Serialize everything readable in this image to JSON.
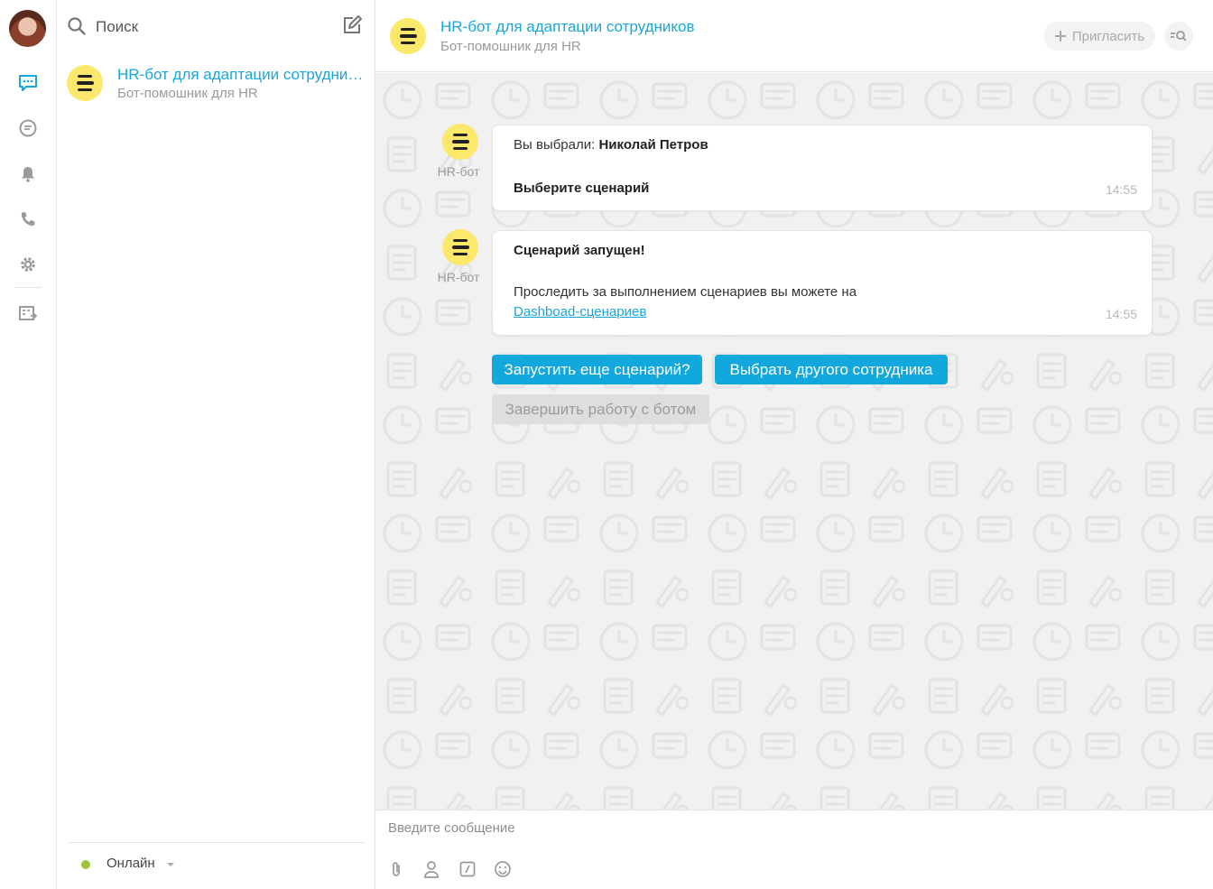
{
  "rail": {
    "items": [
      "chat",
      "messenger",
      "notifications",
      "calls",
      "settings",
      "marketplace"
    ],
    "active_color": "#12a8de",
    "icon_color": "#9b9b9b"
  },
  "sidebar": {
    "search_placeholder": "Поиск",
    "chats": [
      {
        "title": "HR-бот для адаптации сотрудников",
        "subtitle": "Бот-помошник для HR"
      }
    ],
    "status_label": "Онлайн",
    "status_color": "#9ec53a"
  },
  "header": {
    "title": "HR-бот для адаптации сотрудников",
    "subtitle": "Бот-помошник для HR",
    "invite_label": "Пригласить"
  },
  "messages": [
    {
      "author": "HR-бот",
      "line1_prefix": "Вы выбрали: ",
      "line1_bold": "Николай Петров",
      "line2_bold": "Выберите сценарий",
      "time": "14:55"
    },
    {
      "author": "HR-бот",
      "line1_bold": "Сценарий запущен!",
      "line2": "Проследить за выполнением сценариев вы можете на",
      "link": "Dashboad-сценариев",
      "time": "14:55"
    }
  ],
  "keyboard": {
    "run_another": "Запустить еще сценарий?",
    "choose_other": "Выбрать другого сотрудника",
    "finish": "Завершить работу с ботом"
  },
  "composer": {
    "placeholder": "Введите сообщение",
    "tools": [
      "attach-icon",
      "contact-icon",
      "command-icon",
      "smile-icon"
    ]
  },
  "colors": {
    "accent": "#1aa6d9",
    "button": "#12a8de",
    "bot_avatar": "#fce86b",
    "feed_bg": "#f1f1f1"
  }
}
